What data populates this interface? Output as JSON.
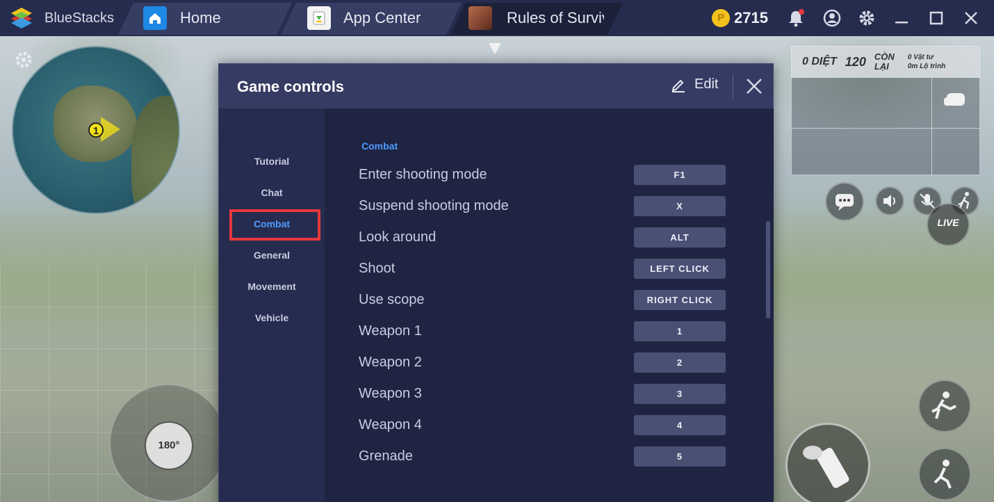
{
  "app": {
    "name": "BlueStacks"
  },
  "tabs": [
    {
      "label": "Home"
    },
    {
      "label": "App Center"
    },
    {
      "label": "Rules of Surviva"
    }
  ],
  "topbar": {
    "coin_symbol": "P",
    "coins": "2715"
  },
  "dialog": {
    "title": "Game controls",
    "edit_label": "Edit",
    "sidebar": [
      "Tutorial",
      "Chat",
      "Combat",
      "General",
      "Movement",
      "Vehicle"
    ],
    "active_category": "Combat",
    "section": "Combat",
    "bindings": [
      {
        "action": "Enter shooting mode",
        "key": "F1"
      },
      {
        "action": "Suspend shooting mode",
        "key": "X"
      },
      {
        "action": "Look around",
        "key": "ALT"
      },
      {
        "action": "Shoot",
        "key": "LEFT CLICK"
      },
      {
        "action": "Use scope",
        "key": "RIGHT CLICK"
      },
      {
        "action": "Weapon 1",
        "key": "1"
      },
      {
        "action": "Weapon 2",
        "key": "2"
      },
      {
        "action": "Weapon 3",
        "key": "3"
      },
      {
        "action": "Weapon 4",
        "key": "4"
      },
      {
        "action": "Grenade",
        "key": "5"
      }
    ]
  },
  "hud": {
    "kills": "0 DIỆT",
    "alive_count": "120",
    "alive_label": "CÒN LẠI",
    "supplies": "0 Vật tư",
    "distance": "0m Lộ trình",
    "minimap_marker": "1",
    "turn_label": "180°",
    "live_label": "LIVE"
  },
  "colors": {
    "accent": "#4f9bff",
    "highlight": "#e8383b",
    "dialog_bg": "#23284a",
    "topbar": "#262c4d"
  }
}
